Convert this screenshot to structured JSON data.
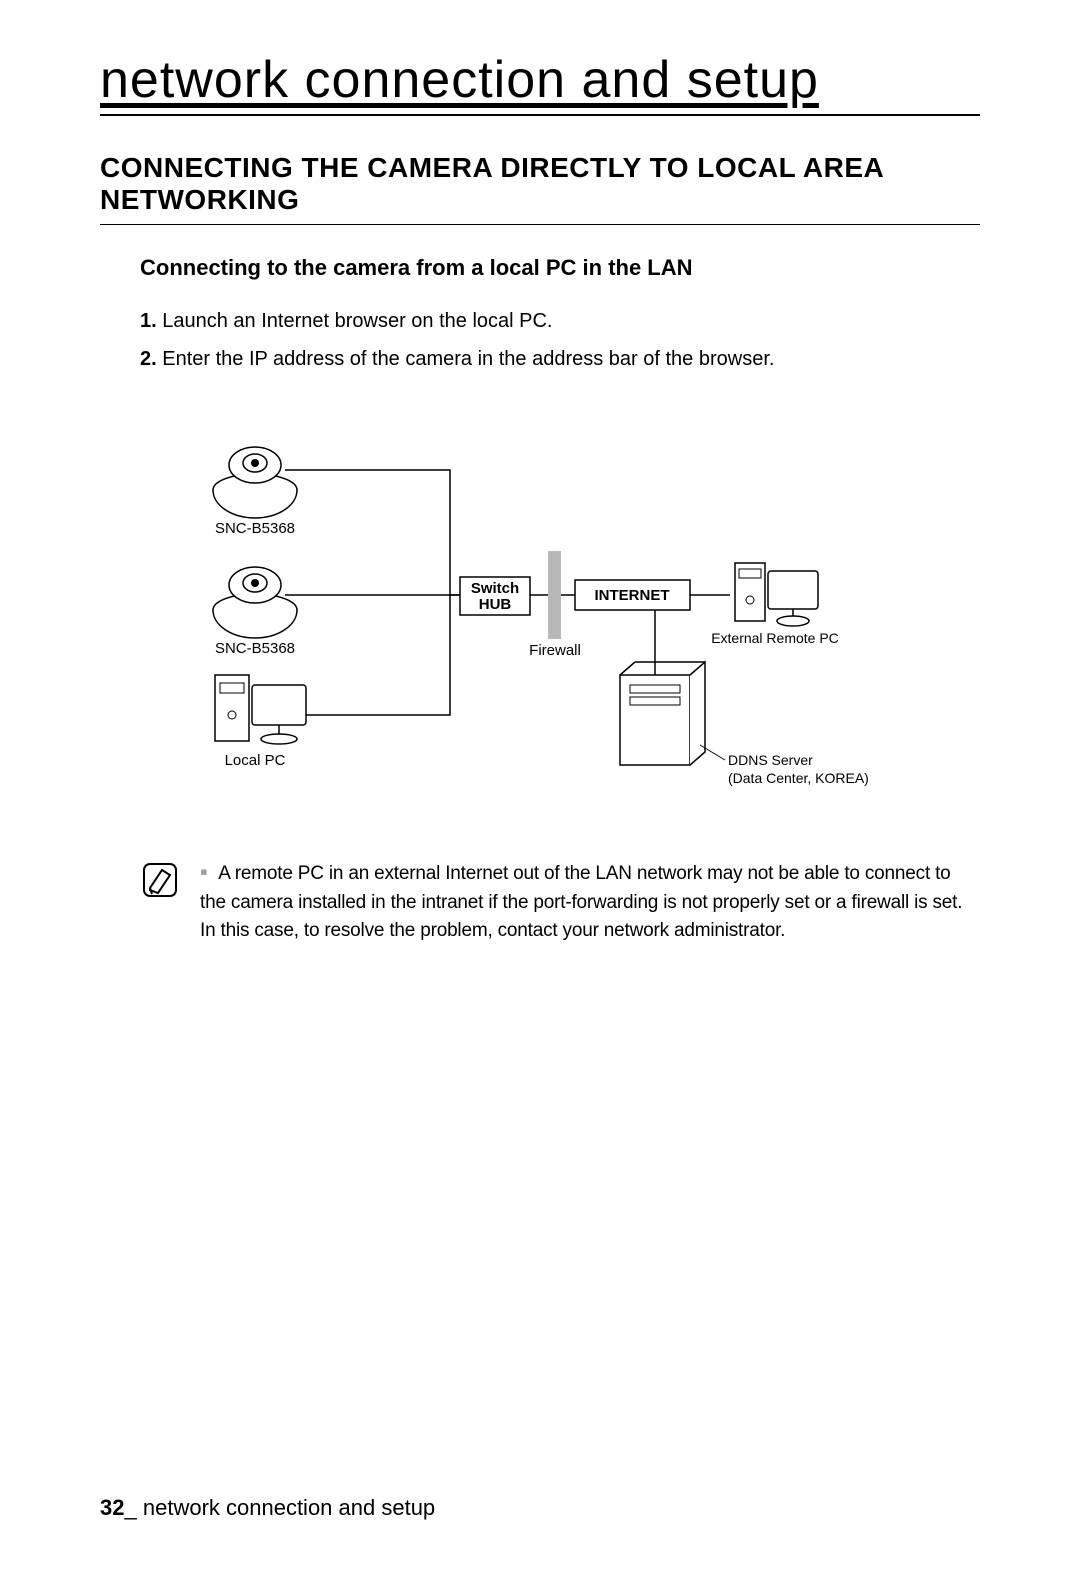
{
  "chapter_title": "network connection and setup",
  "section_title": "CONNECTING THE CAMERA DIRECTLY TO LOCAL AREA NETWORKING",
  "subsection_title": "Connecting to the camera from a local PC in the LAN",
  "steps": [
    {
      "num": "1.",
      "text": "Launch an Internet browser on the local PC."
    },
    {
      "num": "2.",
      "text": "Enter the IP address of the camera in the address bar of the browser."
    }
  ],
  "diagram": {
    "camera1_label": "SNC-B5368",
    "camera2_label": "SNC-B5368",
    "local_pc_label": "Local PC",
    "switch_hub_label_line1": "Switch",
    "switch_hub_label_line2": "HUB",
    "firewall_label": "Firewall",
    "internet_label": "INTERNET",
    "external_pc_label": "External Remote PC",
    "ddns_label_line1": "DDNS Server",
    "ddns_label_line2": "(Data Center, KOREA)"
  },
  "note_text": "A remote PC in an external Internet out of the LAN network may not be able to connect to the camera installed in the intranet if the port-forwarding is not properly set or a firewall is set. In this case, to resolve the problem, contact your network administrator.",
  "footer": {
    "page_number": "32",
    "separator": "_",
    "label": "network connection and setup"
  }
}
